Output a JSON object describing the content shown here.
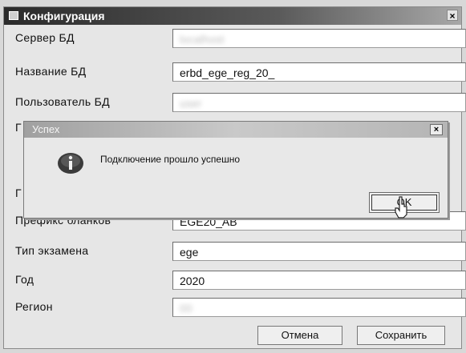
{
  "window": {
    "title": "Конфигурация",
    "close_glyph": "×"
  },
  "fields": [
    {
      "label": "Сервер БД",
      "value": "localhost",
      "blurred": true
    },
    {
      "label": "Название БД",
      "value": "erbd_ege_reg_20_",
      "blurred": false
    },
    {
      "label": "Пользователь БД",
      "value": "user",
      "blurred": true
    },
    {
      "label": "Префикс бланков",
      "value": "EGE20_AB",
      "blurred": false
    },
    {
      "label": "Тип экзамена",
      "value": "ege",
      "blurred": false
    },
    {
      "label": "Год",
      "value": "2020",
      "blurred": false
    },
    {
      "label": "Регион",
      "value": "00",
      "blurred": true
    }
  ],
  "buttons": {
    "cancel": "Отмена",
    "save": "Сохранить"
  },
  "dialog": {
    "title": "Успех",
    "close_glyph": "×",
    "message": "Подключение прошло успешно",
    "ok": "OK",
    "icon": "info-icon"
  },
  "partial_labels": {
    "hidden_top": "Г",
    "hidden_bottom": "Г"
  }
}
